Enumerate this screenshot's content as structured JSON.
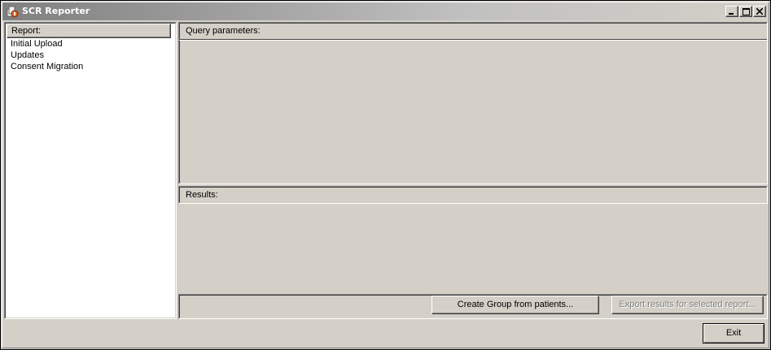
{
  "window": {
    "title": "SCR Reporter",
    "app_icon": "scr-reporter-app-icon",
    "controls": {
      "minimize_icon": "minimize-icon",
      "maximize_icon": "maximize-icon",
      "close_icon": "close-icon"
    }
  },
  "report_list": {
    "header": "Report:",
    "items": [
      {
        "label": "Initial Upload"
      },
      {
        "label": "Updates"
      },
      {
        "label": "Consent Migration"
      }
    ]
  },
  "query_panel": {
    "header": "Query parameters:"
  },
  "results_panel": {
    "header": "Results:"
  },
  "buttons": {
    "create_group": "Create Group from patients...",
    "export_results": "Export results for selected report...",
    "exit": "Exit"
  },
  "colors": {
    "face": "#d4d0c8",
    "title_gradient_start": "#808080",
    "disabled_text": "#808080"
  }
}
